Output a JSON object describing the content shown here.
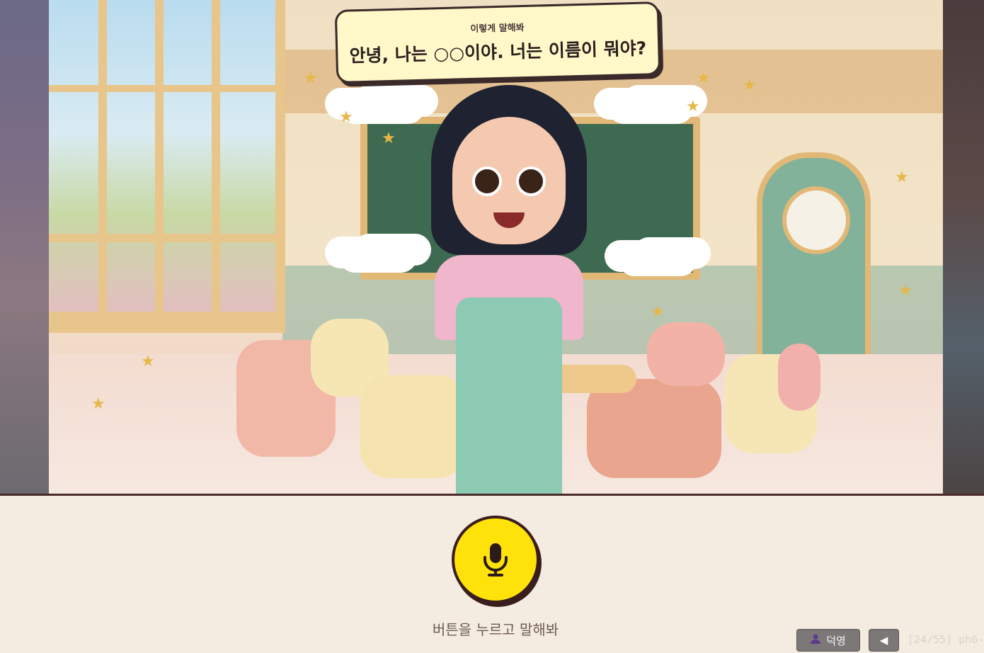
{
  "speech_bubble": {
    "hint": "이렇게 말해봐",
    "sentence": "안녕, 나는 ○○이야. 너는 이름이 뭐야?"
  },
  "mic": {
    "icon": "microphone-icon",
    "instruction": "버튼을 누르고 말해봐"
  },
  "footer": {
    "user_icon": "user-icon",
    "user_name": "덕영",
    "back_icon": "back-arrow-icon",
    "back_glyph": "◀",
    "page_counter": "[24/55] ph6-"
  },
  "colors": {
    "background": "#f4ece0",
    "mic_yellow": "#ffe20a",
    "bubble_fill": "#fff8c8",
    "outline": "#3a1e1e",
    "footer_button": "#7c7878"
  }
}
